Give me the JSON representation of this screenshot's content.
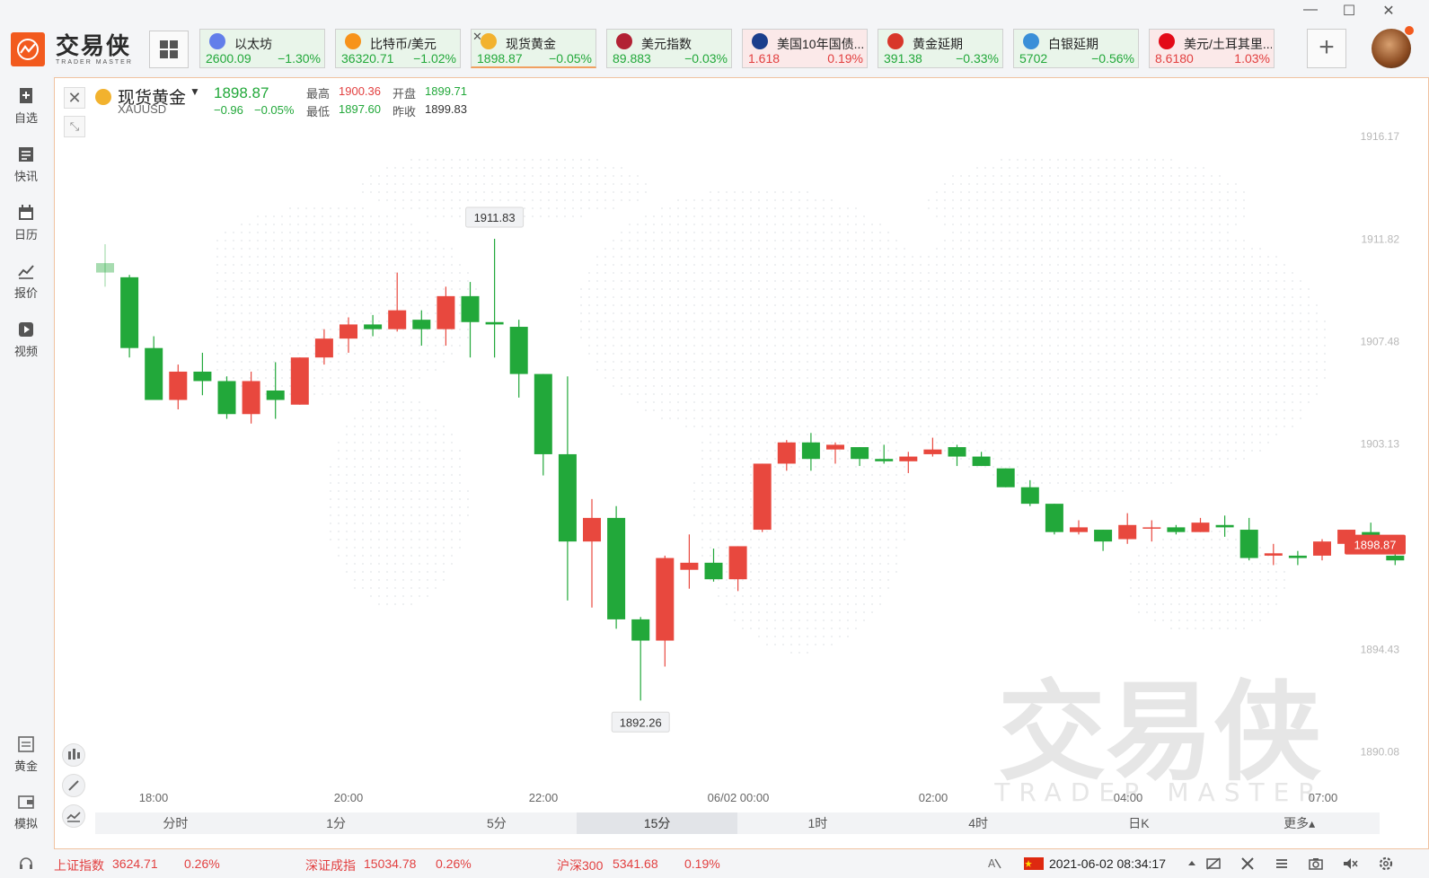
{
  "app": {
    "logo_cn": "交易侠",
    "logo_en": "TRADER MASTER"
  },
  "window": {
    "minimize": "—",
    "maximize": "☐",
    "close": "✕"
  },
  "tickers": [
    {
      "name": "以太坊",
      "price": "2600.09",
      "change": "−1.30%",
      "trend": "down",
      "icon": "ethereum-icon",
      "color": "#627eea"
    },
    {
      "name": "比特币/美元",
      "price": "36320.71",
      "change": "−1.02%",
      "trend": "down",
      "icon": "bitcoin-icon",
      "color": "#f7931a"
    },
    {
      "name": "现货黄金",
      "price": "1898.87",
      "change": "−0.05%",
      "trend": "down",
      "icon": "gold-icon",
      "color": "#f2b22e",
      "active": true
    },
    {
      "name": "美元指数",
      "price": "89.883",
      "change": "−0.03%",
      "trend": "down",
      "icon": "us-flag-icon",
      "color": "#b22234"
    },
    {
      "name": "美国10年国债...",
      "price": "1.618",
      "change": "0.19%",
      "trend": "up",
      "icon": "bond-icon",
      "color": "#1a3e8c"
    },
    {
      "name": "黄金延期",
      "price": "391.38",
      "change": "−0.33%",
      "trend": "down",
      "icon": "gold-td-icon",
      "color": "#d8372a"
    },
    {
      "name": "白银延期",
      "price": "5702",
      "change": "−0.56%",
      "trend": "down",
      "icon": "silver-td-icon",
      "color": "#3a8fd8"
    },
    {
      "name": "美元/土耳其里...",
      "price": "8.6180",
      "change": "1.03%",
      "trend": "up",
      "icon": "usd-try-icon",
      "color": "#e30a17"
    }
  ],
  "add_label": "+",
  "sidebar": [
    {
      "label": "自选",
      "icon": "bookmark-add-icon"
    },
    {
      "label": "快讯",
      "icon": "news-icon"
    },
    {
      "label": "日历",
      "icon": "calendar-icon"
    },
    {
      "label": "报价",
      "icon": "quote-chart-icon"
    },
    {
      "label": "视频",
      "icon": "video-icon"
    }
  ],
  "sidebar_bottom": [
    {
      "label": "黄金",
      "icon": "gold-bar-icon"
    },
    {
      "label": "模拟",
      "icon": "wallet-icon"
    }
  ],
  "instrument": {
    "name": "现货黄金",
    "code": "XAUUSD",
    "price": "1898.87",
    "change": "−0.96",
    "change_pct": "−0.05%",
    "high_label": "最高",
    "high": "1900.36",
    "open_label": "开盘",
    "open": "1899.71",
    "low_label": "最低",
    "low": "1897.60",
    "prev_label": "昨收",
    "prev": "1899.83",
    "close_btn": "✕",
    "shrink_btn": "⤡"
  },
  "chart_data": {
    "type": "candlestick",
    "interval": "15分",
    "ylim": [
      1888.2,
      1917.5
    ],
    "y_ticks": [
      "1916.17",
      "1911.82",
      "1907.48",
      "1903.13",
      "1894.43",
      "1890.08"
    ],
    "x_ticks": [
      "18:00",
      "20:00",
      "22:00",
      "06/02 00:00",
      "02:00",
      "04:00",
      "07:00"
    ],
    "last_price": "1898.87",
    "high_marker": "1911.83",
    "low_marker": "1892.26",
    "candles": [
      [
        1910.8,
        1910.4,
        1911.6,
        1909.8
      ],
      [
        1910.2,
        1907.2,
        1910.3,
        1906.8
      ],
      [
        1907.2,
        1905.0,
        1907.7,
        1905.0
      ],
      [
        1905.0,
        1906.2,
        1906.5,
        1904.6
      ],
      [
        1906.2,
        1905.8,
        1907.0,
        1905.2
      ],
      [
        1905.8,
        1904.4,
        1906.0,
        1904.2
      ],
      [
        1904.4,
        1905.8,
        1906.2,
        1904.0
      ],
      [
        1905.4,
        1905.0,
        1906.6,
        1904.2
      ],
      [
        1904.8,
        1906.8,
        1906.8,
        1904.8
      ],
      [
        1906.8,
        1907.6,
        1908.0,
        1906.5
      ],
      [
        1907.6,
        1908.2,
        1908.5,
        1907.0
      ],
      [
        1908.2,
        1908.0,
        1908.6,
        1907.7
      ],
      [
        1908.0,
        1908.8,
        1910.4,
        1907.9
      ],
      [
        1908.4,
        1908.0,
        1908.8,
        1907.3
      ],
      [
        1908.0,
        1909.4,
        1909.8,
        1907.3
      ],
      [
        1909.4,
        1908.3,
        1910.0,
        1906.8
      ],
      [
        1908.3,
        1908.2,
        1911.83,
        1906.8
      ],
      [
        1908.1,
        1906.1,
        1908.4,
        1905.1
      ],
      [
        1906.1,
        1902.7,
        1906.1,
        1901.8
      ],
      [
        1902.7,
        1899.0,
        1906.0,
        1896.5
      ],
      [
        1899.0,
        1900.0,
        1900.8,
        1896.2
      ],
      [
        1900.0,
        1895.7,
        1900.5,
        1895.3
      ],
      [
        1895.7,
        1894.8,
        1895.8,
        1892.26
      ],
      [
        1894.8,
        1898.3,
        1898.4,
        1893.7
      ],
      [
        1897.8,
        1898.1,
        1899.3,
        1897.0
      ],
      [
        1898.1,
        1897.4,
        1898.7,
        1897.3
      ],
      [
        1897.4,
        1898.8,
        1898.8,
        1896.9
      ],
      [
        1899.5,
        1902.3,
        1902.3,
        1899.4
      ],
      [
        1902.3,
        1903.2,
        1903.3,
        1902.0
      ],
      [
        1903.2,
        1902.5,
        1903.6,
        1902.0
      ],
      [
        1902.9,
        1903.1,
        1903.2,
        1902.3
      ],
      [
        1903.0,
        1902.5,
        1903.0,
        1902.2
      ],
      [
        1902.5,
        1902.4,
        1903.1,
        1902.3
      ],
      [
        1902.4,
        1902.6,
        1902.8,
        1901.9
      ],
      [
        1902.7,
        1902.9,
        1903.4,
        1902.6
      ],
      [
        1903.0,
        1902.6,
        1903.1,
        1902.2
      ],
      [
        1902.6,
        1902.2,
        1902.8,
        1902.2
      ],
      [
        1902.1,
        1901.3,
        1902.1,
        1901.3
      ],
      [
        1901.3,
        1900.6,
        1901.6,
        1900.5
      ],
      [
        1900.6,
        1899.4,
        1900.6,
        1899.3
      ],
      [
        1899.4,
        1899.6,
        1899.9,
        1899.3
      ],
      [
        1899.5,
        1899.0,
        1899.5,
        1898.6
      ],
      [
        1899.1,
        1899.7,
        1900.2,
        1898.9
      ],
      [
        1899.6,
        1899.6,
        1899.9,
        1899.0
      ],
      [
        1899.6,
        1899.4,
        1899.7,
        1899.3
      ],
      [
        1899.4,
        1899.8,
        1900.0,
        1899.4
      ],
      [
        1899.7,
        1899.6,
        1900.1,
        1899.2
      ],
      [
        1899.5,
        1898.3,
        1900.0,
        1898.2
      ],
      [
        1898.4,
        1898.5,
        1898.9,
        1898.0
      ],
      [
        1898.4,
        1898.3,
        1898.6,
        1898.0
      ],
      [
        1898.4,
        1899.0,
        1899.1,
        1898.2
      ],
      [
        1898.9,
        1899.5,
        1899.5,
        1898.8
      ],
      [
        1899.4,
        1899.0,
        1899.8,
        1898.5
      ],
      [
        1898.4,
        1898.2,
        1898.6,
        1898.0
      ]
    ]
  },
  "timeframes": [
    "分时",
    "1分",
    "5分",
    "15分",
    "1时",
    "4时",
    "日K",
    "更多▴"
  ],
  "active_timeframe": "15分",
  "watermark": {
    "cn": "交易侠",
    "en": "TRADER MASTER"
  },
  "status_bar": {
    "idx1_name": "上证指数",
    "idx1_value": "3624.71",
    "idx1_change": "0.26%",
    "idx2_name": "深证成指",
    "idx2_value": "15034.78",
    "idx2_change": "0.26%",
    "idx3_name": "沪深300",
    "idx3_value": "5341.68",
    "idx3_change": "0.19%",
    "datetime": "2021-06-02 08:34:17"
  },
  "colors": {
    "up": "#e8483e",
    "down": "#22a83a",
    "accent": "#f25a1e"
  }
}
